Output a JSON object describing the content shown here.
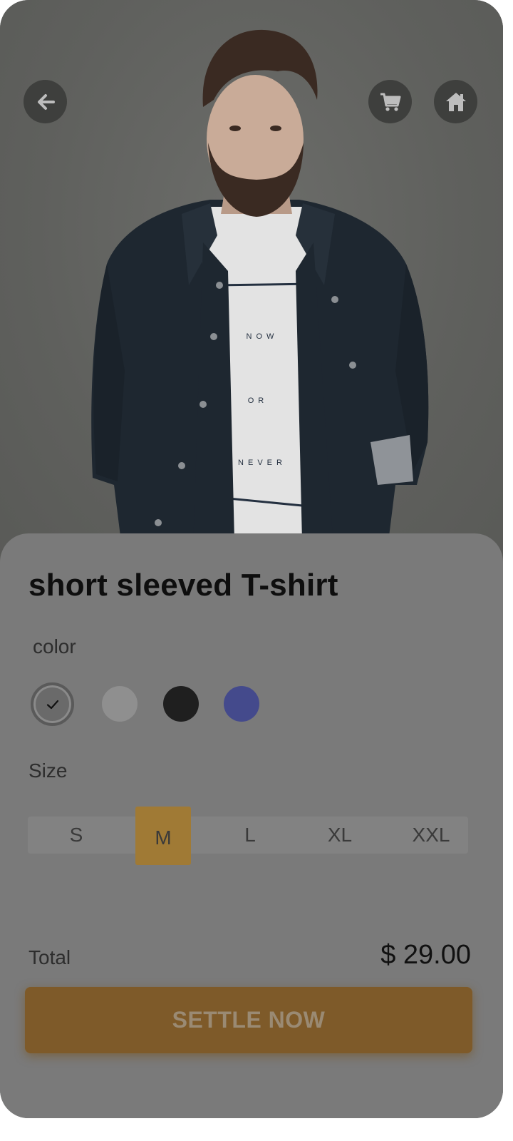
{
  "header": {
    "back_icon": "arrow-left-icon",
    "cart_icon": "cart-icon",
    "home_icon": "home-icon"
  },
  "product": {
    "title": "short sleeved T-shirt",
    "image_alt": "man in denim jacket and white t-shirt",
    "shirt_print": [
      "NOW",
      "OR",
      "NEVER"
    ]
  },
  "color": {
    "label": "color",
    "swatches": [
      {
        "name": "gray-dark",
        "hex": "#6a6a6a",
        "selected": true
      },
      {
        "name": "gray",
        "hex": "#8f8f8f",
        "selected": false
      },
      {
        "name": "black",
        "hex": "#1f1f1f",
        "selected": false
      },
      {
        "name": "blue",
        "hex": "#444a8c",
        "selected": false
      }
    ]
  },
  "size": {
    "label": "Size",
    "options": [
      "S",
      "M",
      "L",
      "XL",
      "XXL"
    ],
    "selected": "M"
  },
  "total": {
    "label": "Total",
    "value": "$ 29.00"
  },
  "cta": {
    "label": "SETTLE NOW"
  },
  "colors": {
    "accent": "#a07a35",
    "cta_bg": "#7e5a29",
    "sheet_bg": "#7a7a7a",
    "overlay_bg": "#646562"
  }
}
